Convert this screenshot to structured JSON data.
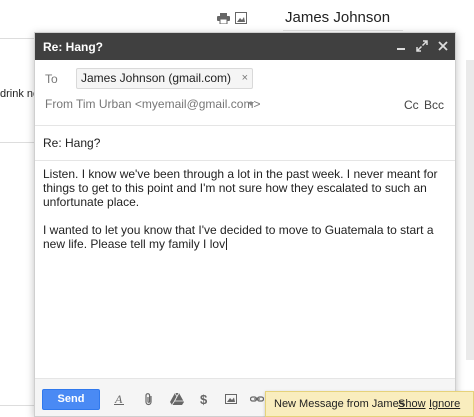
{
  "background": {
    "contact_name": "James Johnson",
    "snippet_text": "drink nex"
  },
  "compose": {
    "title": "Re: Hang?",
    "to_label": "To",
    "recipient": "James Johnson (gmail.com)",
    "recipient_remove": "×",
    "from_label": "From",
    "from_value": "Tim Urban <myemail@gmail.com>",
    "cc_label": "Cc",
    "bcc_label": "Bcc",
    "subject": "Re: Hang?",
    "body": {
      "paragraph1": "Listen. I know we've been through a lot in the past week. I never meant for things to get to this point and I'm not sure how they escalated to such an unfortunate place.",
      "paragraph2": "I wanted to let you know that I've decided to move to Guatemala to start a new life. Please tell my family I lov"
    },
    "send_label": "Send",
    "toolbar_icons": [
      "text-format-icon",
      "attach-icon",
      "drive-icon",
      "money-icon",
      "photo-icon",
      "link-icon"
    ]
  },
  "notification": {
    "text": "New Message from James",
    "show_label": "Show",
    "ignore_label": "Ignore"
  },
  "colors": {
    "header_bg": "#404040",
    "send_button": "#4a8af4",
    "notification_bg": "#f9edbe"
  }
}
